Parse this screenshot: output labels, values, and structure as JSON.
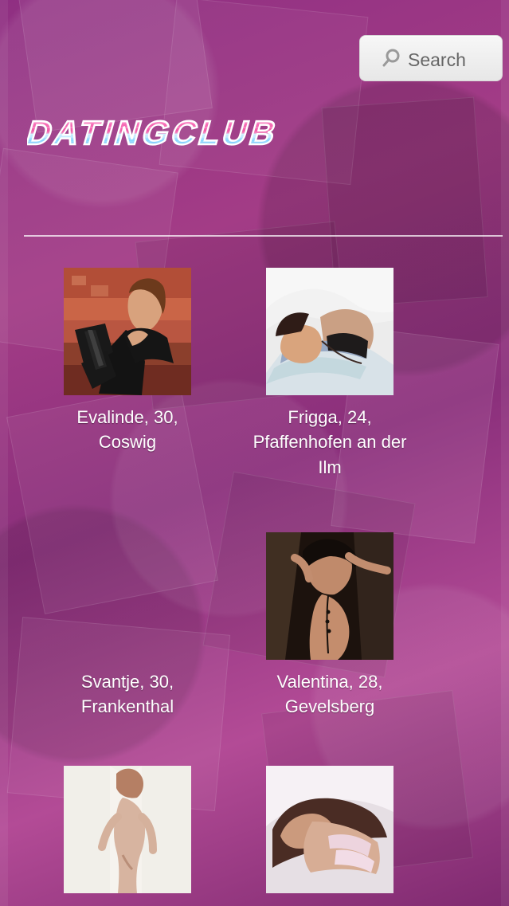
{
  "search": {
    "label": "Search"
  },
  "logo": {
    "text": "DATINGCLUB"
  },
  "profiles": [
    {
      "caption": "Evalinde, 30,\nCoswig"
    },
    {
      "caption": "Frigga, 24,\nPfaffenhofen an der\nIlm"
    },
    {
      "caption": "Svantje, 30,\nFrankenthal"
    },
    {
      "caption": "Valentina, 28,\nGevelsberg"
    },
    {
      "caption": ""
    },
    {
      "caption": ""
    }
  ]
}
